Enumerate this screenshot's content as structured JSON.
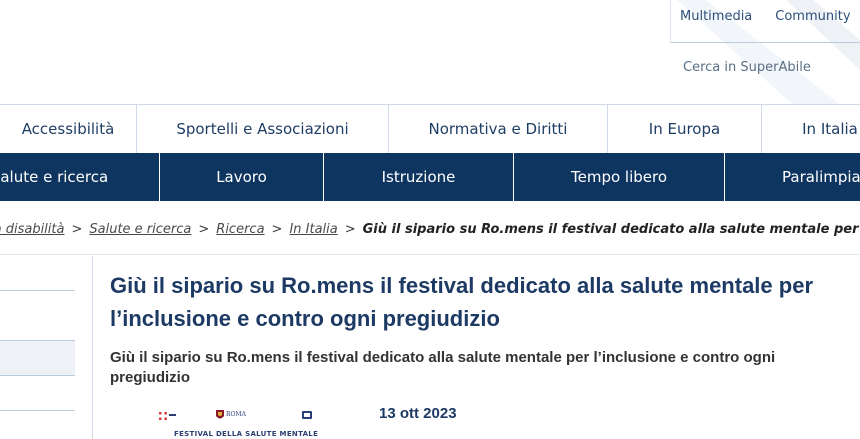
{
  "utility": {
    "links": [
      "Multimedia",
      "Community"
    ],
    "search_label": "Cerca in SuperAbile"
  },
  "nav_primary": [
    "Accessibilità",
    "Sportelli e Associazioni",
    "Normativa e Diritti",
    "In Europa",
    "In Italia"
  ],
  "nav_secondary": [
    "Salute e ricerca",
    "Lavoro",
    "Istruzione",
    "Tempo libero",
    "Paralimpiadi"
  ],
  "breadcrumb": {
    "links": [
      "la disabilità",
      "Salute e ricerca",
      "Ricerca",
      "In Italia"
    ],
    "separator": ">",
    "current": "Giù il sipario su Ro.mens il festival dedicato alla salute mentale per l’inclusione"
  },
  "article": {
    "title": "Giù il sipario su Ro.mens il festival dedicato alla salute mentale per l’inclusione e contro ogni pregiudizio",
    "subtitle": "Giù il sipario su Ro.mens il festival dedicato alla salute mentale per l’inclusione e contro ogni pregiudizio",
    "date": "13 ott 2023",
    "image_caption": "FESTIVAL DELLA SALUTE MENTALE",
    "image_logo_text": "ROMA"
  },
  "colors": {
    "nav_dark": "#0e3560",
    "title_blue": "#1c3a63",
    "link_blue": "#2c4f7a"
  }
}
